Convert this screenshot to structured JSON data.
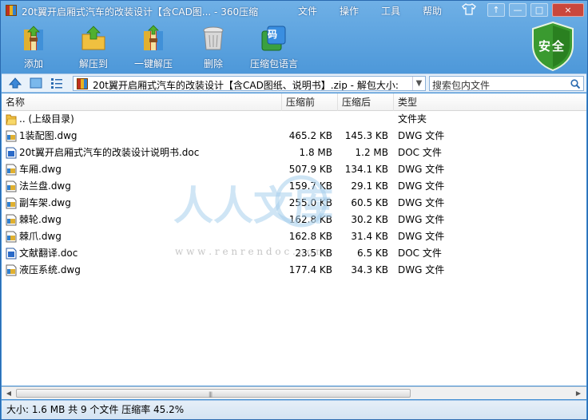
{
  "window": {
    "title": "20t翼开启厢式汽车的改装设计【含CAD图... - 360压缩",
    "menu": [
      "文件",
      "操作",
      "工具",
      "帮助"
    ],
    "controls": [
      "↑",
      "—",
      "□",
      "×"
    ]
  },
  "toolbar": {
    "add_label": "添加",
    "extract_label": "解压到",
    "oneclick_label": "一键解压",
    "delete_label": "删除",
    "lang_label": "压缩包语言",
    "lang_badge": "码",
    "security_label": "安全"
  },
  "address": {
    "path": "20t翼开启厢式汽车的改装设计【含CAD图纸、说明书】.zip - 解包大小:",
    "search_placeholder": "搜索包内文件"
  },
  "list": {
    "columns": [
      "名称",
      "压缩前",
      "压缩后",
      "类型"
    ],
    "rows": [
      {
        "name": ".. (上级目录)",
        "size": "",
        "packed": "",
        "type": "文件夹",
        "icon": "folder-icon"
      },
      {
        "name": "1装配图.dwg",
        "size": "465.2 KB",
        "packed": "145.3 KB",
        "type": "DWG 文件",
        "icon": "dwg-file-icon"
      },
      {
        "name": "20t翼开启厢式汽车的改装设计说明书.doc",
        "size": "1.8 MB",
        "packed": "1.2 MB",
        "type": "DOC 文件",
        "icon": "doc-file-icon"
      },
      {
        "name": "车厢.dwg",
        "size": "507.9 KB",
        "packed": "134.1 KB",
        "type": "DWG 文件",
        "icon": "dwg-file-icon"
      },
      {
        "name": "法兰盘.dwg",
        "size": "159.7 KB",
        "packed": "29.1 KB",
        "type": "DWG 文件",
        "icon": "dwg-file-icon"
      },
      {
        "name": "副车架.dwg",
        "size": "255.0 KB",
        "packed": "60.5 KB",
        "type": "DWG 文件",
        "icon": "dwg-file-icon"
      },
      {
        "name": "棘轮.dwg",
        "size": "162.8 KB",
        "packed": "30.2 KB",
        "type": "DWG 文件",
        "icon": "dwg-file-icon"
      },
      {
        "name": "棘爪.dwg",
        "size": "162.8 KB",
        "packed": "31.4 KB",
        "type": "DWG 文件",
        "icon": "dwg-file-icon"
      },
      {
        "name": "文献翻译.doc",
        "size": "23.5 KB",
        "packed": "6.5 KB",
        "type": "DOC 文件",
        "icon": "doc-file-icon"
      },
      {
        "name": "液压系统.dwg",
        "size": "177.4 KB",
        "packed": "34.3 KB",
        "type": "DWG 文件",
        "icon": "dwg-file-icon"
      }
    ]
  },
  "status": {
    "text": "大小: 1.6 MB 共 9 个文件 压缩率 45.2%"
  },
  "watermark": {
    "text": "人人文库",
    "url": "w w w . r e n r e n d o c . c o m"
  }
}
